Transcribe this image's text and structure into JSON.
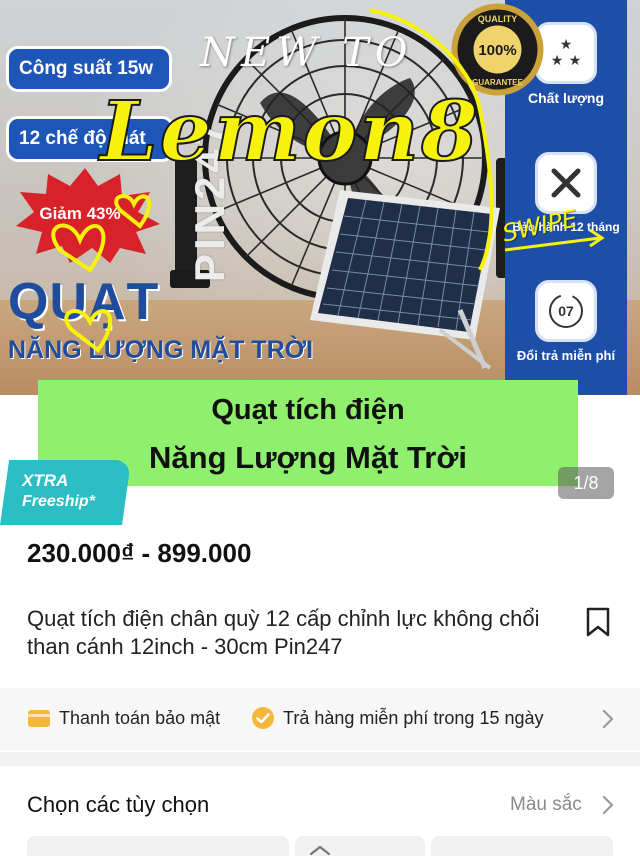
{
  "gallery": {
    "features": {
      "quality": "Chất lượng",
      "warranty": "Bảo hành 12 tháng",
      "returns": "Đổi trả miễn phí",
      "returns_days": "07"
    },
    "badges": {
      "power": "Công suất 15w",
      "modes": "12 chế độ mát",
      "discount": "Giảm 43%",
      "quality_seal": [
        "QUALITY",
        "100%",
        "GUARANTEE"
      ]
    },
    "headline_big": "QUẠT",
    "headline_sub": "NĂNG LƯỢNG MẶT TRỜI",
    "brand_vertical": "PIN247",
    "watermark_top": "NEW TO",
    "watermark_main": "Lemon8",
    "swipe_text": "SWIPE",
    "caption_line1": "Quạt tích điện",
    "caption_line2": "Năng Lượng Mặt Trời",
    "counter": "1/8"
  },
  "xtra": {
    "line1": "XTRA",
    "line2": "Freeship*"
  },
  "product": {
    "price": "230.000₫ - 899.000",
    "title": "Quạt tích điện chân quỳ 12 cấp chỉnh lực không chổi than cánh 12inch - 30cm Pin247"
  },
  "guarantees": {
    "secure_payment": "Thanh toán bảo mật",
    "free_return": "Trả hàng miễn phí trong 15 ngày"
  },
  "options": {
    "title": "Chọn các tùy chọn",
    "hint": "Màu sắc"
  },
  "colors": {
    "caption_green": "#8ff06d",
    "xtra_teal": "#2bbfc5",
    "strip_blue": "#1e4fa8",
    "badge_blue": "#1e55b8",
    "doodle_yellow": "#f6f20a"
  }
}
